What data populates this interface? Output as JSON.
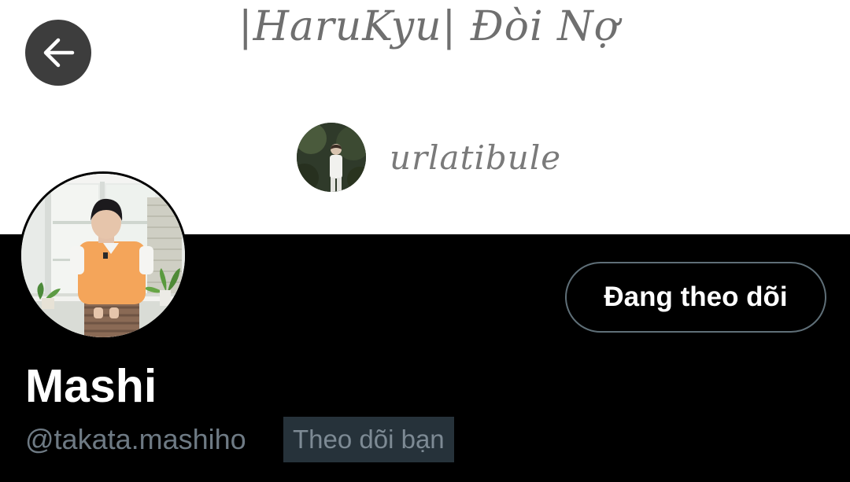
{
  "header": {
    "banner_title": "|HaruKyu| Đòi Nợ",
    "banner_username": "urlatibule",
    "back_icon": "arrow-left-icon"
  },
  "profile": {
    "display_name": "Mashi",
    "handle": "@takata.mashiho",
    "follows_you_label": "Theo dõi bạn",
    "follow_button_label": "Đang theo dõi"
  },
  "colors": {
    "banner_bg": "#ffffff",
    "page_bg": "#000000",
    "back_button_bg": "#3d3d3d",
    "button_border": "#5f6f78",
    "handle_text": "#6e7a84",
    "badge_bg": "#26323a"
  }
}
